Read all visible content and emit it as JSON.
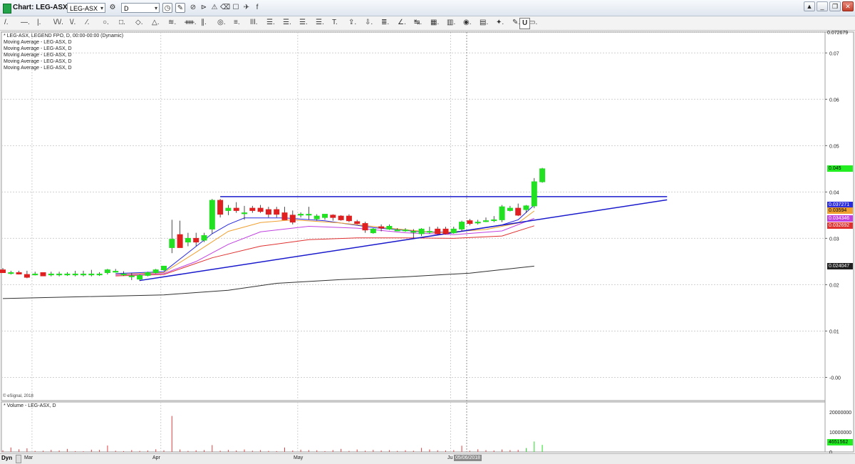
{
  "window": {
    "title": "Chart: LEG-ASX, D",
    "symbol": "LEG-ASX",
    "interval": "D"
  },
  "toolbar": {
    "tools": [
      "/.",
      "—.",
      "|.",
      "\\/\\/.",
      "\\/.",
      "⁄.",
      "○.",
      "□.",
      "◇.",
      "△.",
      "≋.",
      "ᚔ.",
      "∥.",
      "◎.",
      "≡.",
      "ǀǀǀ.",
      "☰.",
      "☰.",
      "☰.",
      "☰.",
      "T.",
      "⇪.",
      "⇩.",
      "≣.",
      "∠.",
      "↹.",
      "▦.",
      "▥.",
      "◉.",
      "▤.",
      "✦.",
      "✎.",
      "▭."
    ],
    "last_tool": "U"
  },
  "legend": {
    "main": "* LEG-ASX, LEGEND FPO, D, 00:00-00:00 (Dynamic)",
    "ma": [
      "Moving Average - LEG-ASX, D",
      "Moving Average - LEG-ASX, D",
      "Moving Average - LEG-ASX, D",
      "Moving Average - LEG-ASX, D",
      "Moving Average - LEG-ASX, D"
    ]
  },
  "copyright": "© eSignal, 2018",
  "volume_legend": "* Volume - LEG-ASX, D",
  "status": {
    "dyn": "Dyn",
    "cursor_date": "05/06/2018"
  },
  "colors": {
    "up": "#22e022",
    "down": "#e02020",
    "trend": "#1a1acd",
    "ma_fast": "#2a2adf",
    "ma2": "#f0a030",
    "ma3": "#c040e0",
    "ma4": "#e03030",
    "ma5": "#303030",
    "vol": "#e04040"
  },
  "chart_data": [
    {
      "type": "candlestick",
      "ylim": [
        -0.005,
        0.0745
      ],
      "y_ticks": [
        "0.07",
        "0.06",
        "0.05",
        "0.04",
        "0.03",
        "0.02",
        "0.01",
        "-0.00"
      ],
      "x_labels": [
        "Mar",
        "Apr",
        "May",
        "Ju"
      ],
      "last_price_label": "0.072679",
      "candles": [
        {
          "o": 0.0232,
          "h": 0.0236,
          "l": 0.0226,
          "c": 0.0226
        },
        {
          "o": 0.0226,
          "h": 0.023,
          "l": 0.0222,
          "c": 0.0226
        },
        {
          "o": 0.0226,
          "h": 0.023,
          "l": 0.0222,
          "c": 0.0223
        },
        {
          "o": 0.0222,
          "h": 0.023,
          "l": 0.0214,
          "c": 0.0216
        },
        {
          "o": 0.0223,
          "h": 0.0228,
          "l": 0.022,
          "c": 0.0223
        },
        {
          "o": 0.0226,
          "h": 0.0226,
          "l": 0.0219,
          "c": 0.0219
        },
        {
          "o": 0.0223,
          "h": 0.0228,
          "l": 0.0218,
          "c": 0.0223
        },
        {
          "o": 0.0223,
          "h": 0.0228,
          "l": 0.0218,
          "c": 0.0223
        },
        {
          "o": 0.0223,
          "h": 0.0227,
          "l": 0.0219,
          "c": 0.0223
        },
        {
          "o": 0.0223,
          "h": 0.023,
          "l": 0.0218,
          "c": 0.0223
        },
        {
          "o": 0.0223,
          "h": 0.023,
          "l": 0.0218,
          "c": 0.0223
        },
        {
          "o": 0.0223,
          "h": 0.0232,
          "l": 0.0218,
          "c": 0.0223
        },
        {
          "o": 0.0223,
          "h": 0.0227,
          "l": 0.0219,
          "c": 0.0223
        },
        {
          "o": 0.0226,
          "h": 0.0234,
          "l": 0.0222,
          "c": 0.0232
        },
        {
          "o": 0.0229,
          "h": 0.0234,
          "l": 0.0226,
          "c": 0.0229
        },
        {
          "o": 0.0223,
          "h": 0.0229,
          "l": 0.0219,
          "c": 0.0223
        },
        {
          "o": 0.0219,
          "h": 0.0225,
          "l": 0.021,
          "c": 0.0219
        },
        {
          "o": 0.0212,
          "h": 0.0222,
          "l": 0.0208,
          "c": 0.022
        },
        {
          "o": 0.022,
          "h": 0.0228,
          "l": 0.0218,
          "c": 0.0226
        },
        {
          "o": 0.0226,
          "h": 0.0234,
          "l": 0.0224,
          "c": 0.0232
        },
        {
          "o": 0.0232,
          "h": 0.024,
          "l": 0.023,
          "c": 0.024
        },
        {
          "o": 0.028,
          "h": 0.034,
          "l": 0.0268,
          "c": 0.0298
        },
        {
          "o": 0.0308,
          "h": 0.0338,
          "l": 0.0285,
          "c": 0.028
        },
        {
          "o": 0.0292,
          "h": 0.0312,
          "l": 0.0283,
          "c": 0.03
        },
        {
          "o": 0.03,
          "h": 0.0312,
          "l": 0.0283,
          "c": 0.0292
        },
        {
          "o": 0.0296,
          "h": 0.0312,
          "l": 0.0292,
          "c": 0.0306
        },
        {
          "o": 0.032,
          "h": 0.0385,
          "l": 0.031,
          "c": 0.0382
        },
        {
          "o": 0.0382,
          "h": 0.0385,
          "l": 0.0345,
          "c": 0.0352
        },
        {
          "o": 0.036,
          "h": 0.0372,
          "l": 0.035,
          "c": 0.0365
        },
        {
          "o": 0.0365,
          "h": 0.0378,
          "l": 0.0355,
          "c": 0.036
        },
        {
          "o": 0.0355,
          "h": 0.037,
          "l": 0.034,
          "c": 0.0355
        },
        {
          "o": 0.0365,
          "h": 0.037,
          "l": 0.0355,
          "c": 0.036
        },
        {
          "o": 0.0365,
          "h": 0.0372,
          "l": 0.0355,
          "c": 0.0358
        },
        {
          "o": 0.0362,
          "h": 0.0368,
          "l": 0.0345,
          "c": 0.0352
        },
        {
          "o": 0.0362,
          "h": 0.0368,
          "l": 0.0345,
          "c": 0.0352
        },
        {
          "o": 0.0355,
          "h": 0.0368,
          "l": 0.034,
          "c": 0.034
        },
        {
          "o": 0.035,
          "h": 0.036,
          "l": 0.033,
          "c": 0.0335
        },
        {
          "o": 0.0352,
          "h": 0.0356,
          "l": 0.0345,
          "c": 0.0352
        },
        {
          "o": 0.0352,
          "h": 0.0368,
          "l": 0.034,
          "c": 0.0352
        },
        {
          "o": 0.0342,
          "h": 0.0352,
          "l": 0.0338,
          "c": 0.0348
        },
        {
          "o": 0.0345,
          "h": 0.0352,
          "l": 0.034,
          "c": 0.0352
        },
        {
          "o": 0.035,
          "h": 0.0352,
          "l": 0.0338,
          "c": 0.0345
        },
        {
          "o": 0.0348,
          "h": 0.035,
          "l": 0.0338,
          "c": 0.034
        },
        {
          "o": 0.0348,
          "h": 0.0352,
          "l": 0.0335,
          "c": 0.0338
        },
        {
          "o": 0.0336,
          "h": 0.034,
          "l": 0.033,
          "c": 0.0332
        },
        {
          "o": 0.0332,
          "h": 0.0336,
          "l": 0.0312,
          "c": 0.0318
        },
        {
          "o": 0.0312,
          "h": 0.0322,
          "l": 0.031,
          "c": 0.032
        },
        {
          "o": 0.0325,
          "h": 0.033,
          "l": 0.0315,
          "c": 0.0322
        },
        {
          "o": 0.032,
          "h": 0.033,
          "l": 0.0318,
          "c": 0.0326
        },
        {
          "o": 0.0318,
          "h": 0.0322,
          "l": 0.0316,
          "c": 0.0318
        },
        {
          "o": 0.0318,
          "h": 0.0322,
          "l": 0.0314,
          "c": 0.0318
        },
        {
          "o": 0.0315,
          "h": 0.032,
          "l": 0.03,
          "c": 0.0315
        },
        {
          "o": 0.031,
          "h": 0.0322,
          "l": 0.0305,
          "c": 0.032
        },
        {
          "o": 0.0315,
          "h": 0.0325,
          "l": 0.031,
          "c": 0.0315
        },
        {
          "o": 0.032,
          "h": 0.0325,
          "l": 0.0308,
          "c": 0.031
        },
        {
          "o": 0.032,
          "h": 0.0325,
          "l": 0.0308,
          "c": 0.031
        },
        {
          "o": 0.0312,
          "h": 0.0325,
          "l": 0.031,
          "c": 0.032
        },
        {
          "o": 0.032,
          "h": 0.0338,
          "l": 0.0315,
          "c": 0.0335
        },
        {
          "o": 0.0338,
          "h": 0.0342,
          "l": 0.0328,
          "c": 0.0332
        },
        {
          "o": 0.0335,
          "h": 0.034,
          "l": 0.033,
          "c": 0.0335
        },
        {
          "o": 0.0338,
          "h": 0.0345,
          "l": 0.0335,
          "c": 0.0338
        },
        {
          "o": 0.034,
          "h": 0.0348,
          "l": 0.0335,
          "c": 0.034
        },
        {
          "o": 0.034,
          "h": 0.0372,
          "l": 0.0335,
          "c": 0.0368
        },
        {
          "o": 0.036,
          "h": 0.037,
          "l": 0.0358,
          "c": 0.0365
        },
        {
          "o": 0.0365,
          "h": 0.0375,
          "l": 0.0348,
          "c": 0.035
        },
        {
          "o": 0.0362,
          "h": 0.0372,
          "l": 0.0355,
          "c": 0.037
        },
        {
          "o": 0.037,
          "h": 0.043,
          "l": 0.0365,
          "c": 0.0422
        },
        {
          "o": 0.0422,
          "h": 0.0452,
          "l": 0.042,
          "c": 0.045
        }
      ],
      "moving_averages": [
        {
          "label_value": "0.037271",
          "color": "#2a2adf",
          "points": [
            [
              14,
              0.0224
            ],
            [
              20,
              0.0228
            ],
            [
              26,
              0.031
            ],
            [
              28,
              0.033
            ],
            [
              30,
              0.0344
            ],
            [
              35,
              0.0344
            ],
            [
              40,
              0.0338
            ],
            [
              46,
              0.0323
            ],
            [
              52,
              0.0314
            ],
            [
              56,
              0.0313
            ],
            [
              62,
              0.0329
            ],
            [
              64,
              0.034
            ],
            [
              66,
              0.0372
            ]
          ]
        },
        {
          "label_value": "0.03594",
          "color": "#f0a030",
          "points": [
            [
              14,
              0.0222
            ],
            [
              20,
              0.0226
            ],
            [
              24,
              0.027
            ],
            [
              28,
              0.0315
            ],
            [
              32,
              0.0334
            ],
            [
              36,
              0.034
            ],
            [
              42,
              0.0333
            ],
            [
              48,
              0.0322
            ],
            [
              54,
              0.0312
            ],
            [
              60,
              0.0319
            ],
            [
              64,
              0.0333
            ],
            [
              66,
              0.0359
            ]
          ]
        },
        {
          "label_value": "0.034346",
          "color": "#c040e0",
          "points": [
            [
              14,
              0.0221
            ],
            [
              20,
              0.0224
            ],
            [
              24,
              0.025
            ],
            [
              28,
              0.0287
            ],
            [
              32,
              0.0314
            ],
            [
              38,
              0.0326
            ],
            [
              44,
              0.0322
            ],
            [
              50,
              0.0312
            ],
            [
              56,
              0.0308
            ],
            [
              62,
              0.0316
            ],
            [
              66,
              0.0343
            ]
          ]
        },
        {
          "label_value": "0.032692",
          "color": "#e03030",
          "points": [
            [
              14,
              0.0219
            ],
            [
              20,
              0.0222
            ],
            [
              26,
              0.0258
            ],
            [
              32,
              0.0283
            ],
            [
              38,
              0.0297
            ],
            [
              44,
              0.0301
            ],
            [
              50,
              0.0301
            ],
            [
              56,
              0.03
            ],
            [
              62,
              0.0305
            ],
            [
              66,
              0.0327
            ]
          ]
        },
        {
          "label_value": "0.024047",
          "color": "#303030",
          "points": [
            [
              0,
              0.017
            ],
            [
              20,
              0.0178
            ],
            [
              28,
              0.0188
            ],
            [
              34,
              0.0203
            ],
            [
              42,
              0.0211
            ],
            [
              50,
              0.0217
            ],
            [
              58,
              0.0225
            ],
            [
              66,
              0.024
            ]
          ]
        }
      ],
      "trend_lines": [
        {
          "from": [
            17,
            0.0209
          ],
          "to": [
            82.5,
            0.0383
          ],
          "name": "rising-support"
        },
        {
          "from": [
            27,
            0.039
          ],
          "to": [
            82.5,
            0.039
          ],
          "name": "horizontal-resistance"
        }
      ],
      "current_price_label": "0.045"
    },
    {
      "type": "bar",
      "name": "Volume",
      "ylim": [
        0,
        25000000
      ],
      "y_ticks": [
        "20000000",
        "10000000",
        "0"
      ],
      "last_volume_label": "4651562",
      "values": [
        800000,
        2200000,
        1300000,
        1800000,
        500000,
        600000,
        1000000,
        700000,
        1500000,
        400000,
        300000,
        1100000,
        1000000,
        3200000,
        600000,
        400000,
        900000,
        500000,
        700000,
        1300000,
        800000,
        18000000,
        1200000,
        500000,
        800000,
        900000,
        3400000,
        600000,
        1000000,
        700000,
        1200000,
        600000,
        900000,
        500000,
        400000,
        2200000,
        700000,
        1100000,
        900000,
        800000,
        400000,
        900000,
        1500000,
        500000,
        1200000,
        600000,
        1000000,
        700000,
        900000,
        500000,
        800000,
        600000,
        2000000,
        1200000,
        800000,
        700000,
        900000,
        3100000,
        600000,
        1300000,
        900000,
        700000,
        1200000,
        900000,
        1000000,
        1900000,
        5200000,
        3500000
      ]
    }
  ]
}
